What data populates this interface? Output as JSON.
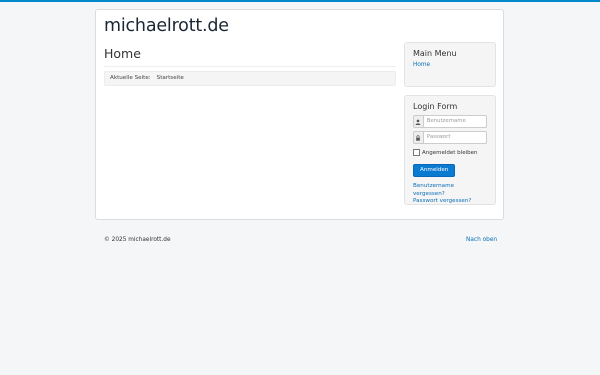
{
  "site": {
    "brand": "michaelrott.de"
  },
  "main": {
    "title": "Home",
    "breadcrumb": {
      "prefix": "Aktuelle Seite:",
      "current": "Startseite"
    }
  },
  "sidebar": {
    "menu": {
      "title": "Main Menu",
      "items": [
        {
          "label": "Home"
        }
      ]
    },
    "login": {
      "title": "Login Form",
      "username_placeholder": "Benutzername",
      "password_placeholder": "Passwort",
      "remember_label": "Angemeldet bleiben",
      "submit_label": "Anmelden",
      "forgot_username": "Benutzername vergessen?",
      "forgot_password": "Passwort vergessen?"
    }
  },
  "footer": {
    "copyright": "© 2025 michaelrott.de",
    "back_to_top": "Nach oben"
  },
  "colors": {
    "accent": "#0088cc",
    "link": "#0a6fb7",
    "button": "#0b7ad1",
    "page_bg": "#f4f6f7"
  },
  "icons": {
    "username": "user-icon",
    "password": "lock-icon"
  }
}
